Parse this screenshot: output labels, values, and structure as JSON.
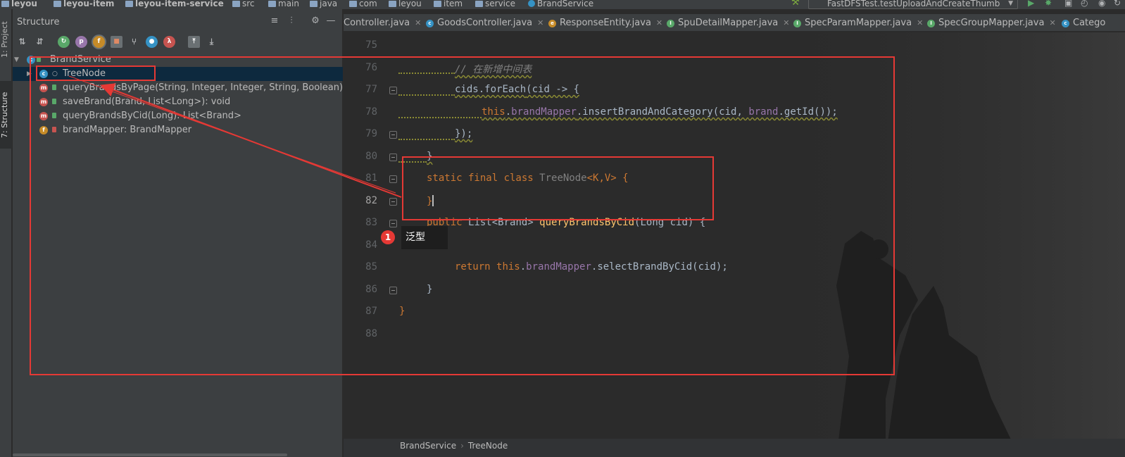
{
  "navbar": {
    "crumbs": [
      "leyou",
      "leyou-item",
      "leyou-item-service",
      "src",
      "main",
      "java",
      "com",
      "leyou",
      "item",
      "service",
      "BrandService"
    ],
    "run_config": "FastDFSTest.testUploadAndCreateThumb"
  },
  "left_strip": {
    "project_tab": "1: Project",
    "structure_tab": "7: Structure"
  },
  "structure": {
    "title": "Structure",
    "toolbar": [
      "p",
      "f",
      "λ"
    ],
    "tree": [
      {
        "label": "BrandService",
        "icon": "class-icon",
        "level": 0
      },
      {
        "label": "TreeNode",
        "icon": "class-icon",
        "level": 1,
        "selected": true
      },
      {
        "label": "queryBrandsByPage(String, Integer, Integer, String, Boolean): Page",
        "icon": "method-icon",
        "level": 1
      },
      {
        "label": "saveBrand(Brand, List<Long>): void",
        "icon": "method-icon",
        "level": 1
      },
      {
        "label": "queryBrandsByCid(Long): List<Brand>",
        "icon": "method-icon",
        "level": 1
      },
      {
        "label": "brandMapper: BrandMapper",
        "icon": "field-icon",
        "level": 1
      }
    ]
  },
  "tabs": [
    {
      "label": "Controller.java",
      "icon": ""
    },
    {
      "label": "GoodsController.java",
      "icon": "class-icon"
    },
    {
      "label": "ResponseEntity.java",
      "icon": "enum-icon"
    },
    {
      "label": "SpuDetailMapper.java",
      "icon": "interface-icon"
    },
    {
      "label": "SpecParamMapper.java",
      "icon": "interface-icon"
    },
    {
      "label": "SpecGroupMapper.java",
      "icon": "interface-icon"
    },
    {
      "label": "Catego",
      "icon": "class-icon"
    }
  ],
  "editor": {
    "line_numbers": [
      "75",
      "76",
      "77",
      "78",
      "79",
      "80",
      "81",
      "82",
      "83",
      "84",
      "85",
      "86",
      "87",
      "88"
    ],
    "current_line": "82",
    "code": {
      "l76_comment": "// 在新增中间表",
      "l77_a": "cids.",
      "l77_fn": "forEach",
      "l77_b": "(cid -> {",
      "l78_this": "this",
      "l78_dot1": ".",
      "l78_field": "brandMapper",
      "l78_call": ".insertBrandAndCategory(cid, ",
      "l78_brand": "brand",
      "l78_end": ".getId());",
      "l79": "});",
      "l80": "}",
      "l81_kw": "static final class ",
      "l81_name": "TreeNode",
      "l81_gen": "<K,V>",
      "l81_brace": " {",
      "l82": "}",
      "l83_kw": "public ",
      "l83_type": "List<Brand> ",
      "l83_fn": "queryBrandsByCid",
      "l83_rest": "(Long cid) {",
      "l85_kw": "return ",
      "l85_this": "this",
      "l85_dot": ".",
      "l85_field": "brandMapper",
      "l85_rest": ".selectBrandByCid(cid);",
      "l86": "}",
      "l87": "}"
    },
    "breadcrumb": [
      "BrandService",
      "TreeNode"
    ]
  },
  "annotation": {
    "badge": "1",
    "tooltip": "泛型"
  },
  "colors": {
    "annotation_red": "#e53935",
    "keyword": "#cc7832",
    "field": "#9876aa",
    "method": "#ffc66d"
  }
}
